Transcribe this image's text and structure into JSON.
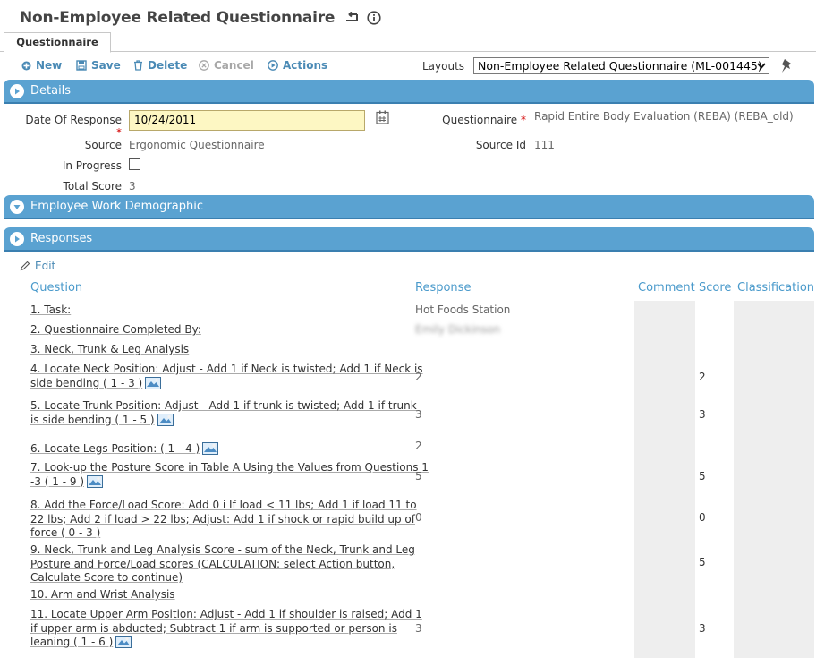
{
  "header": {
    "title": "Non-Employee Related Questionnaire"
  },
  "tabs": [
    {
      "label": "Questionnaire"
    }
  ],
  "toolbar": {
    "new_label": "New",
    "save_label": "Save",
    "delete_label": "Delete",
    "cancel_label": "Cancel",
    "actions_label": "Actions",
    "layouts_label": "Layouts",
    "layout_selected": "Non-Employee Related Questionnaire (ML-001445)"
  },
  "sections": {
    "details": "Details",
    "demographic": "Employee Work Demographic",
    "responses": "Responses"
  },
  "details": {
    "date_label": "Date Of Response",
    "date_value": "10/24/2011",
    "questionnaire_label": "Questionnaire",
    "questionnaire_value": "Rapid Entire Body Evaluation (REBA) (REBA_old)",
    "source_label": "Source",
    "source_value": "Ergonomic Questionnaire",
    "source_id_label": "Source Id",
    "source_id_value": "111",
    "in_progress_label": "In Progress",
    "in_progress_checked": false,
    "total_score_label": "Total Score",
    "total_score_value": "3"
  },
  "responses": {
    "edit_label": "Edit",
    "columns": {
      "question": "Question",
      "response": "Response",
      "comment": "Comment",
      "score": "Score",
      "classification": "Classification"
    },
    "rows": [
      {
        "lines": [
          "1. Task:"
        ],
        "response": "Hot Foods Station",
        "score": ""
      },
      {
        "lines": [
          "2. Questionnaire Completed By:"
        ],
        "response": "Emily Dickinson",
        "score": ""
      },
      {
        "lines": [
          "3. Neck, Trunk & Leg Analysis"
        ],
        "response": "",
        "score": ""
      },
      {
        "lines": [
          "4. Locate Neck Position: Adjust - Add 1 if Neck is twisted; Add 1 if Neck is",
          "side bending ( 1 - 3 )"
        ],
        "response": "2",
        "score": "2"
      },
      {
        "lines": [
          "5. Locate Trunk Position: Adjust - Add 1 if trunk is twisted; Add 1 if trunk",
          "is side bending ( 1 - 5 )"
        ],
        "response": "3",
        "score": "3"
      },
      {
        "lines": [
          "6. Locate Legs Position: ( 1 - 4 )"
        ],
        "response": "2",
        "score": ""
      },
      {
        "lines": [
          "7. Look-up the Posture Score in Table A Using the Values from Questions 1",
          "-3 ( 1 - 9 )"
        ],
        "response": "5",
        "score": "5"
      },
      {
        "lines": [
          "8. Add the Force/Load Score: Add 0 i If load < 11 lbs; Add 1 if load 11 to",
          "22 lbs; Add 2 if load > 22 lbs; Adjust: Add 1 if shock or rapid build up of",
          "force ( 0 - 3 )"
        ],
        "response": "0",
        "score": "0"
      },
      {
        "lines": [
          "9. Neck, Trunk and Leg Analysis Score - sum of the Neck, Trunk and Leg",
          "Posture and Force/Load scores (CALCULATION: select Action button,",
          "Calculate Score to continue)"
        ],
        "response": "",
        "score": "5"
      },
      {
        "lines": [
          "10. Arm and Wrist Analysis"
        ],
        "response": "",
        "score": ""
      },
      {
        "lines": [
          "11. Locate Upper Arm Position: Adjust - Add 1 if shoulder is raised; Add 1",
          "if upper arm is abducted; Subtract 1 if arm is supported or person is",
          "leaning ( 1 - 6 )"
        ],
        "response": "3",
        "score": "3"
      }
    ]
  },
  "colors": {
    "accent": "#4a8ab5",
    "section_bar": "#5aa2d1",
    "date_bg": "#fdf7c3",
    "required": "#d40000"
  }
}
